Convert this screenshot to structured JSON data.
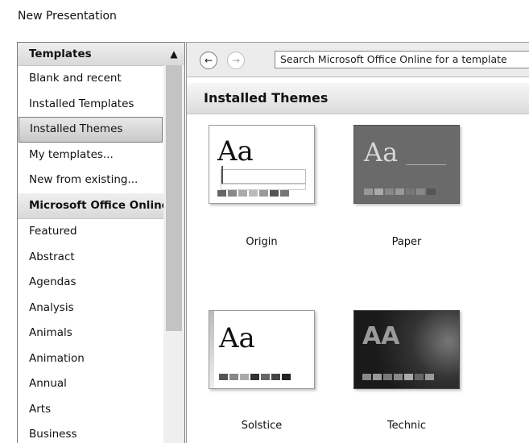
{
  "window": {
    "title": "New Presentation"
  },
  "sidebar": {
    "items": [
      {
        "label": "Templates",
        "kind": "header"
      },
      {
        "label": "Blank and recent",
        "kind": "item"
      },
      {
        "label": "Installed Templates",
        "kind": "item"
      },
      {
        "label": "Installed Themes",
        "kind": "selected"
      },
      {
        "label": "My templates...",
        "kind": "item"
      },
      {
        "label": "New from existing...",
        "kind": "item"
      },
      {
        "label": "Microsoft Office Online",
        "kind": "header"
      },
      {
        "label": "Featured",
        "kind": "item"
      },
      {
        "label": "Abstract",
        "kind": "item"
      },
      {
        "label": "Agendas",
        "kind": "item"
      },
      {
        "label": "Analysis",
        "kind": "item"
      },
      {
        "label": "Animals",
        "kind": "item"
      },
      {
        "label": "Animation",
        "kind": "item"
      },
      {
        "label": "Annual",
        "kind": "item"
      },
      {
        "label": "Arts",
        "kind": "item"
      },
      {
        "label": "Business",
        "kind": "item"
      }
    ]
  },
  "toolbar": {
    "search_value": "Search Microsoft Office Online for a template",
    "back_icon": "back-arrow-icon",
    "forward_icon": "forward-arrow-icon"
  },
  "main": {
    "section_title": "Installed Themes",
    "themes": [
      {
        "name": "Origin",
        "preview_text": "Aa",
        "style": "origin"
      },
      {
        "name": "Paper",
        "preview_text": "Aa",
        "style": "paper"
      },
      {
        "name": "Solstice",
        "preview_text": "Aa",
        "style": "solstice"
      },
      {
        "name": "Technic",
        "preview_text": "AA",
        "style": "technic"
      }
    ]
  },
  "colors": {
    "selection": "#c9c9c9",
    "pane_border": "#7a7a7a"
  }
}
